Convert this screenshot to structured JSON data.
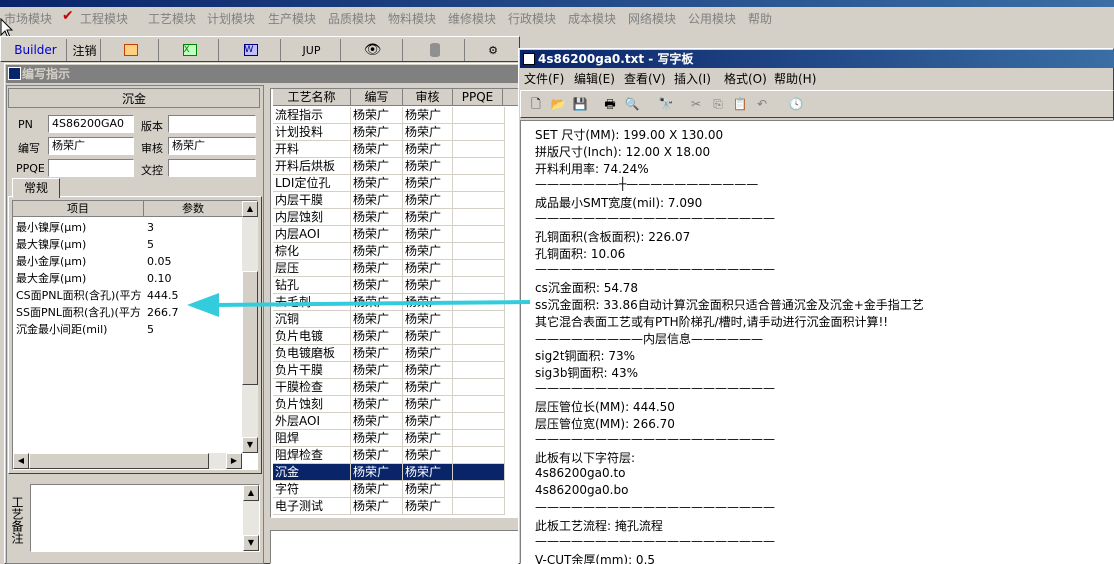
{
  "app": {
    "menu": [
      "市场模块",
      "工程模块",
      "工艺模块",
      "计划模块",
      "生产模块",
      "品质模块",
      "物料模块",
      "维修模块",
      "行政模块",
      "成本模块",
      "网络模块",
      "公用模块",
      "帮助"
    ],
    "toolbar": {
      "builder_label": "Builder",
      "logout_label": "注销",
      "jup_label": "JUP"
    }
  },
  "edit_window": {
    "title": "编写指示",
    "process_name": "沉金",
    "fields": {
      "pn_label": "PN",
      "pn_value": "4S86200GA0",
      "version_label": "版本",
      "version_value": "",
      "writer_label": "编写",
      "writer_value": "杨荣广",
      "reviewer_label": "审核",
      "reviewer_value": "杨荣广",
      "ppqe_label": "PPQE",
      "ppqe_value": "",
      "control_label": "文控",
      "control_value": ""
    },
    "tab_label": "常规",
    "param_grid": {
      "headers": [
        "项目",
        "参数"
      ],
      "rows": [
        {
          "item": "最小镍厚(μm)",
          "value": "3"
        },
        {
          "item": "最大镍厚(μm)",
          "value": "5"
        },
        {
          "item": "最小金厚(μm)",
          "value": "0.05"
        },
        {
          "item": "最大金厚(μm)",
          "value": "0.10"
        },
        {
          "item": "CS面PNL面积(含孔)(平方",
          "value": "444.5"
        },
        {
          "item": "SS面PNL面积(含孔)(平方",
          "value": "266.7"
        },
        {
          "item": "沉金最小间距(mil)",
          "value": "5"
        }
      ]
    },
    "notes_label": "工艺备注"
  },
  "process_table": {
    "headers": [
      "工艺名称",
      "编写",
      "审核",
      "PPQE"
    ],
    "rows": [
      {
        "name": "流程指示",
        "writer": "杨荣广",
        "reviewer": "杨荣广"
      },
      {
        "name": "计划投料",
        "writer": "杨荣广",
        "reviewer": "杨荣广"
      },
      {
        "name": "开料",
        "writer": "杨荣广",
        "reviewer": "杨荣广"
      },
      {
        "name": "开料后烘板",
        "writer": "杨荣广",
        "reviewer": "杨荣广"
      },
      {
        "name": "LDI定位孔",
        "writer": "杨荣广",
        "reviewer": "杨荣广"
      },
      {
        "name": "内层干膜",
        "writer": "杨荣广",
        "reviewer": "杨荣广"
      },
      {
        "name": "内层蚀刻",
        "writer": "杨荣广",
        "reviewer": "杨荣广"
      },
      {
        "name": "内层AOI",
        "writer": "杨荣广",
        "reviewer": "杨荣广"
      },
      {
        "name": "棕化",
        "writer": "杨荣广",
        "reviewer": "杨荣广"
      },
      {
        "name": "层压",
        "writer": "杨荣广",
        "reviewer": "杨荣广"
      },
      {
        "name": "钻孔",
        "writer": "杨荣广",
        "reviewer": "杨荣广"
      },
      {
        "name": "去毛刺",
        "writer": "杨荣广",
        "reviewer": "杨荣广"
      },
      {
        "name": "沉铜",
        "writer": "杨荣广",
        "reviewer": "杨荣广"
      },
      {
        "name": "负片电镀",
        "writer": "杨荣广",
        "reviewer": "杨荣广"
      },
      {
        "name": "负电镀磨板",
        "writer": "杨荣广",
        "reviewer": "杨荣广"
      },
      {
        "name": "负片干膜",
        "writer": "杨荣广",
        "reviewer": "杨荣广"
      },
      {
        "name": "干膜检查",
        "writer": "杨荣广",
        "reviewer": "杨荣广"
      },
      {
        "name": "负片蚀刻",
        "writer": "杨荣广",
        "reviewer": "杨荣广"
      },
      {
        "name": "外层AOI",
        "writer": "杨荣广",
        "reviewer": "杨荣广"
      },
      {
        "name": "阻焊",
        "writer": "杨荣广",
        "reviewer": "杨荣广"
      },
      {
        "name": "阻焊检查",
        "writer": "杨荣广",
        "reviewer": "杨荣广"
      },
      {
        "name": "沉金",
        "writer": "杨荣广",
        "reviewer": "杨荣广"
      },
      {
        "name": "字符",
        "writer": "杨荣广",
        "reviewer": "杨荣广"
      },
      {
        "name": "电子测试",
        "writer": "杨荣广",
        "reviewer": "杨荣广"
      }
    ],
    "selected_index": 21
  },
  "wordpad": {
    "title": "4s86200ga0.txt - 写字板",
    "menu": [
      "文件(F)",
      "编辑(E)",
      "查看(V)",
      "插入(I)",
      "格式(O)",
      "帮助(H)"
    ],
    "lines": [
      "SET 尺寸(MM): 199.00 X 130.00",
      "拼版尺寸(Inch): 12.00 X 18.00",
      "开料利用率: 74.24%",
      "———————┼———————————",
      "成品最小SMT宽度(mil): 7.090",
      "————————————————————",
      "孔铜面积(含板面积): 226.07",
      "孔铜面积: 10.06",
      "————————————————————",
      "cs沉金面积: 54.78",
      "ss沉金面积: 33.86自动计算沉金面积只适合普通沉金及沉金+金手指工艺",
      "其它混合表面工艺或有PTH阶梯孔/槽时,请手动进行沉金面积计算!!",
      "—————————内层信息——————",
      "sig2t铜面积: 73%",
      "sig3b铜面积: 43%",
      "————————————————————",
      "层压管位长(MM): 444.50",
      "层压管位宽(MM): 266.70",
      "————————————————————",
      "此板有以下字符层:",
      "4s86200ga0.to",
      "4s86200ga0.bo",
      "————————————————————",
      "此板工艺流程: 掩孔流程",
      "————————————————————",
      "V-CUT余厚(mm): 0.5"
    ]
  },
  "colors": {
    "title_active": "#0a246a",
    "selection": "#0a246a",
    "arrow": "#33ccdd",
    "check": "#cc0000"
  }
}
